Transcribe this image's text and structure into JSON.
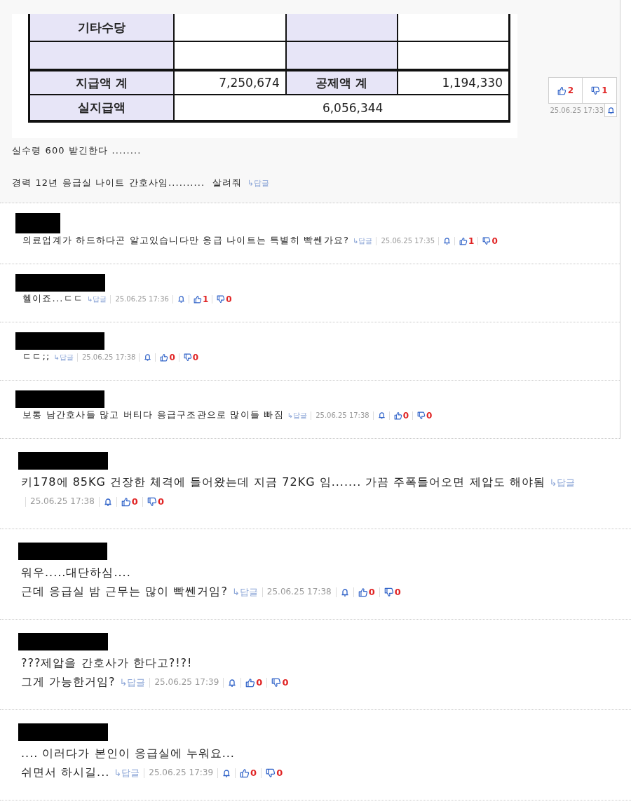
{
  "post": {
    "pay_table": {
      "rows": [
        {
          "kind": "item",
          "cells": [
            {
              "kind": "label",
              "text": "기타수당"
            },
            {
              "kind": "value"
            },
            {
              "kind": "label"
            },
            {
              "kind": "value"
            }
          ]
        },
        {
          "kind": "item",
          "cells": [
            {
              "kind": "label"
            },
            {
              "kind": "value"
            },
            {
              "kind": "label"
            },
            {
              "kind": "value"
            }
          ]
        },
        {
          "kind": "subtotal",
          "cells": [
            {
              "kind": "label",
              "text": "지급액 계"
            },
            {
              "kind": "value",
              "text": "7,250,674"
            },
            {
              "kind": "label",
              "text": "공제액 계"
            },
            {
              "kind": "value",
              "text": "1,194,330"
            }
          ]
        },
        {
          "kind": "net",
          "cells": [
            {
              "kind": "label",
              "text": "실지급액"
            },
            {
              "kind": "merged_value",
              "text": "6,056,344",
              "colspan": 3
            }
          ]
        }
      ]
    },
    "paragraphs": [
      "실수령 600 받긴한다 ........",
      "경력 12년 응급실 나이트 간호사임..........  살려줘"
    ],
    "reply": "↳답글",
    "likes": "2",
    "dislikes": "1",
    "time": "25.06.25 17:33"
  },
  "comments": [
    {
      "lines": [
        "의료업계가 하드하다곤 알고있습니다만 응급 나이트는 특별히 빡쎈가요?"
      ],
      "reply": "↳답글",
      "time": "25.06.25 17:35",
      "likes": "1",
      "dislikes": "0"
    },
    {
      "lines": [
        "헬이죠...ㄷㄷ"
      ],
      "reply": "↳답글",
      "time": "25.06.25 17:36",
      "likes": "1",
      "dislikes": "0"
    },
    {
      "lines": [
        "ㄷㄷ;;"
      ],
      "reply": "↳답글",
      "time": "25.06.25 17:38",
      "likes": "0",
      "dislikes": "0"
    },
    {
      "lines": [
        "보통 남간호사들 많고 버티다 응급구조관으로 많이들 빠짐"
      ],
      "reply": "↳답글",
      "time": "25.06.25 17:38",
      "likes": "0",
      "dislikes": "0"
    }
  ],
  "more_comments": [
    {
      "lines": [
        "키178에 85KG 건장한 체격에 들어왔는데 지금 72KG 임....... 가끔 주폭들어오면 제압도 해야됨"
      ],
      "reply": "↳답글",
      "time": "25.06.25 17:38",
      "likes": "0",
      "dislikes": "0"
    },
    {
      "lines": [
        "워우.....대단하심....",
        "근데 응급실 밤 근무는 많이 빡쎈거임?"
      ],
      "reply": "↳답글",
      "time": "25.06.25 17:38",
      "likes": "0",
      "dislikes": "0"
    },
    {
      "lines": [
        "???제압을 간호사가 한다고?!?!",
        "그게 가능한거임?"
      ],
      "reply": "↳답글",
      "time": "25.06.25 17:39",
      "likes": "0",
      "dislikes": "0"
    },
    {
      "lines": [
        ".... 이러다가 본인이 응급실에 누워요...",
        "쉬면서 하시길..."
      ],
      "reply": "↳답글",
      "time": "25.06.25 17:39",
      "likes": "0",
      "dislikes": "0"
    }
  ]
}
